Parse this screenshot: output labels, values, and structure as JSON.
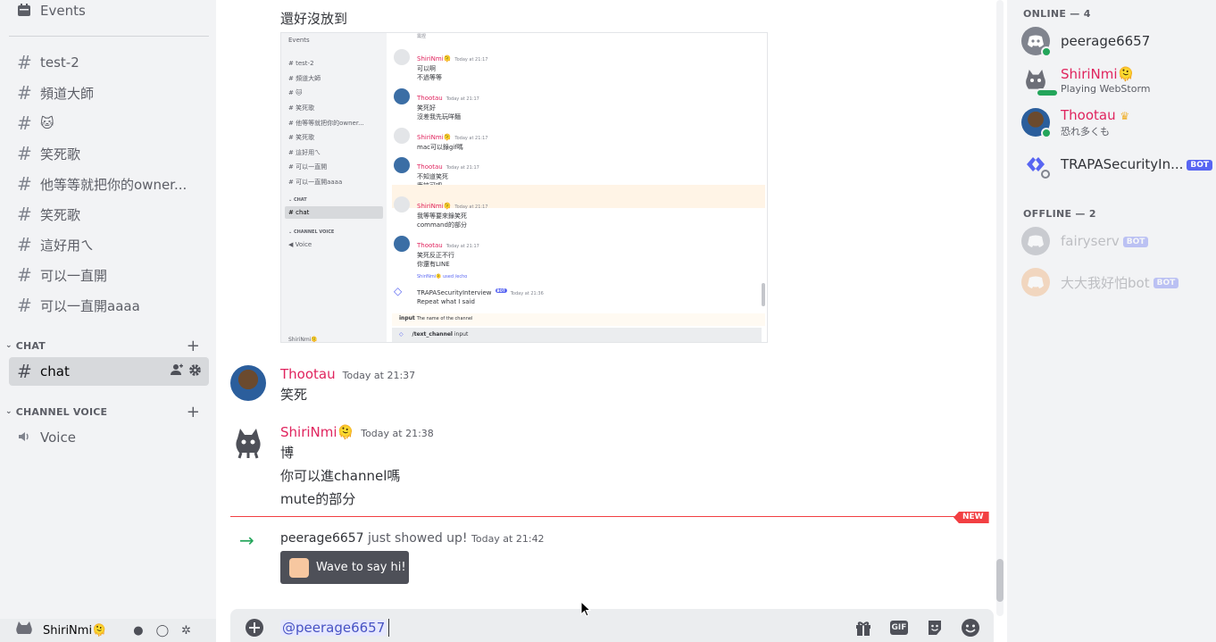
{
  "sidebar": {
    "events_label": "Events",
    "channels": [
      "test-2",
      "頻道大師",
      "🐱",
      "笑死歌",
      "他等等就把你的owner...",
      "笑死歌",
      "這好用ㄟ",
      "可以一直開",
      "可以一直開aaaa"
    ],
    "category_chat": "CHAT",
    "active_channel": "chat",
    "category_voice": "CHANNEL VOICE",
    "voice_channel": "Voice",
    "user_name": "ShiriNmi🫠"
  },
  "chat": {
    "top_text": "還好沒放到",
    "messages": [
      {
        "author": "Thootau",
        "timestamp": "Today at 21:37",
        "lines": [
          "笑死"
        ]
      },
      {
        "author": "ShiriNmi🫠",
        "timestamp": "Today at 21:38",
        "lines": [
          "博",
          "你可以進channel嗎",
          "mute的部分"
        ]
      }
    ],
    "new_badge": "NEW",
    "join": {
      "user": "peerage6657",
      "text": "just showed up!",
      "timestamp": "Today at 21:42"
    },
    "wave_button": "Wave to say hi!",
    "composer_text": "@peerage6657",
    "gif_label": "GIF"
  },
  "embed": {
    "events": "Events",
    "channels": [
      "test-2",
      "頻道大師",
      "🐱",
      "笑死歌",
      "他等等就把你的owner...",
      "笑死歌",
      "這好用ㄟ",
      "可以一直開",
      "可以一直開aaaa"
    ],
    "cat_chat": "CHAT",
    "chat": "chat",
    "cat_voice": "CHANNEL VOICE",
    "voice": "Voice",
    "user": "ShiriNmi🫠",
    "top_line": "需捏",
    "messages": [
      {
        "author": "ShiriNmi🫠",
        "ts": "Today at 21:17",
        "lines": [
          "可以啊",
          "不過等等"
        ]
      },
      {
        "author": "Thootau",
        "ts": "Today at 21:17",
        "lines": [
          "笑死好",
          "沒差我先玩咩麵"
        ]
      },
      {
        "author": "ShiriNmi🫠",
        "ts": "Today at 21:17",
        "lines": [
          "mac可以錄gif嗎"
        ]
      },
      {
        "author": "Thootau",
        "ts": "Today at 21:17",
        "lines": [
          "不知道笑死",
          "應該可吧"
        ]
      },
      {
        "author": "ShiriNmi🫠",
        "ts": "Today at 21:17",
        "lines": [
          "我等等要來錄笑死",
          "command的部分"
        ]
      },
      {
        "author": "Thootau",
        "ts": "Today at 21:17",
        "lines": [
          "笑死反正不行",
          "你還有LINE"
        ]
      }
    ],
    "reply_line": "ShiriNmi🫠 used /echo",
    "bot_name": "TRAPASecurityInterview",
    "bot_tag": "BOT",
    "bot_ts": "Today at 21:36",
    "bot_text": "Repeat what I said",
    "option_name": "input",
    "option_desc": "The name of the channel",
    "command": "/text_channel",
    "command_opt": "input"
  },
  "members": {
    "online_header": "ONLINE — 4",
    "online": [
      {
        "name": "peerage6657",
        "sub": ""
      },
      {
        "name": "ShiriNmi🫠",
        "sub": "Playing WebStorm"
      },
      {
        "name": "Thootau",
        "sub": "恐れ多くも"
      },
      {
        "name": "TRAPASecurityIn...",
        "sub": "",
        "tag": "BOT"
      }
    ],
    "offline_header": "OFFLINE — 2",
    "offline": [
      {
        "name": "fairyserv",
        "tag": "BOT"
      },
      {
        "name": "大大我好怕bot",
        "tag": "BOT"
      }
    ]
  },
  "colors": {
    "accent": "#5865f2",
    "author": "#e0245e",
    "online": "#23a55a",
    "new": "#f23f42"
  }
}
